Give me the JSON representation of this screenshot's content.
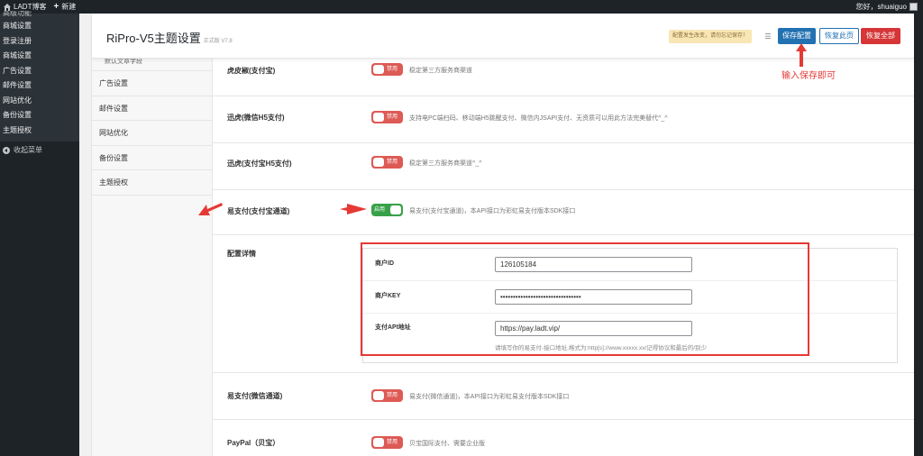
{
  "adminbar": {
    "site": "LADT博客",
    "new": "新建",
    "greeting": "您好，shuaiguo"
  },
  "adminmenu": {
    "cut_item": "高级功能",
    "items": [
      "商城设置",
      "登录注册",
      "商城设置",
      "广告设置",
      "邮件设置",
      "网站优化",
      "备份设置",
      "主题授权"
    ],
    "collapse": "收起菜单"
  },
  "header": {
    "title": "RiPro-V5主题设置",
    "version": "正式版 V7.8",
    "notice": "配置发生改变，请勿忘记保存！",
    "save": "保存配置",
    "reset_page": "恢复此页",
    "reset_all": "恢复全部"
  },
  "sidenav": {
    "partial": "默认文章字段",
    "items": [
      "广告设置",
      "邮件设置",
      "网站优化",
      "备份设置",
      "主题授权"
    ]
  },
  "switch_text": {
    "off": "禁用",
    "on": "启用"
  },
  "rows": {
    "r1": {
      "label": "虎皮椒(支付宝)",
      "desc": "稳定第三方服务商渠道",
      "enabled": false
    },
    "r2": {
      "label": "迅虎(微信H5支付)",
      "desc": "支持电PC端扫码、移动端H5跳醒支付、微信内JSAPI支付、无资质可以用此方法完美替代^_^",
      "enabled": false
    },
    "r3": {
      "label": "迅虎(支付宝H5支付)",
      "desc": "稳定第三方服务商渠道^_^",
      "enabled": false
    },
    "r4": {
      "label": "易支付(支付宝通道)",
      "desc": "易支付(支付宝通道)，本API接口为彩虹易支付版本SDK接口",
      "enabled": true
    },
    "r5": {
      "label": "配置详情"
    },
    "r6": {
      "label": "易支付(微信通道)",
      "desc": "易支付(微信通道)，本API接口为彩虹易支付版本SDK接口",
      "enabled": false
    },
    "r7": {
      "label": "PayPal（贝宝）",
      "desc": "贝宝国际支付、需要企业版",
      "enabled": false
    }
  },
  "detail": {
    "merchant_id_label": "商户ID",
    "merchant_id_value": "126105184",
    "merchant_key_label": "商户KEY",
    "merchant_key_value": "••••••••••••••••••••••••••••••••",
    "api_label": "支付API地址",
    "api_value": "https://pay.ladt.vip/",
    "api_hint": "请填写你的易支付-接口地址,格式为:http[s]://www.xxxxx.xx/记得协议和最后的/别少"
  },
  "annotation": {
    "text": "输入保存即可"
  },
  "colors": {
    "accent": "#2271b1",
    "danger": "#d63638",
    "switch_off": "#dd5a55",
    "switch_on": "#38a148",
    "annotation": "#e53935"
  }
}
